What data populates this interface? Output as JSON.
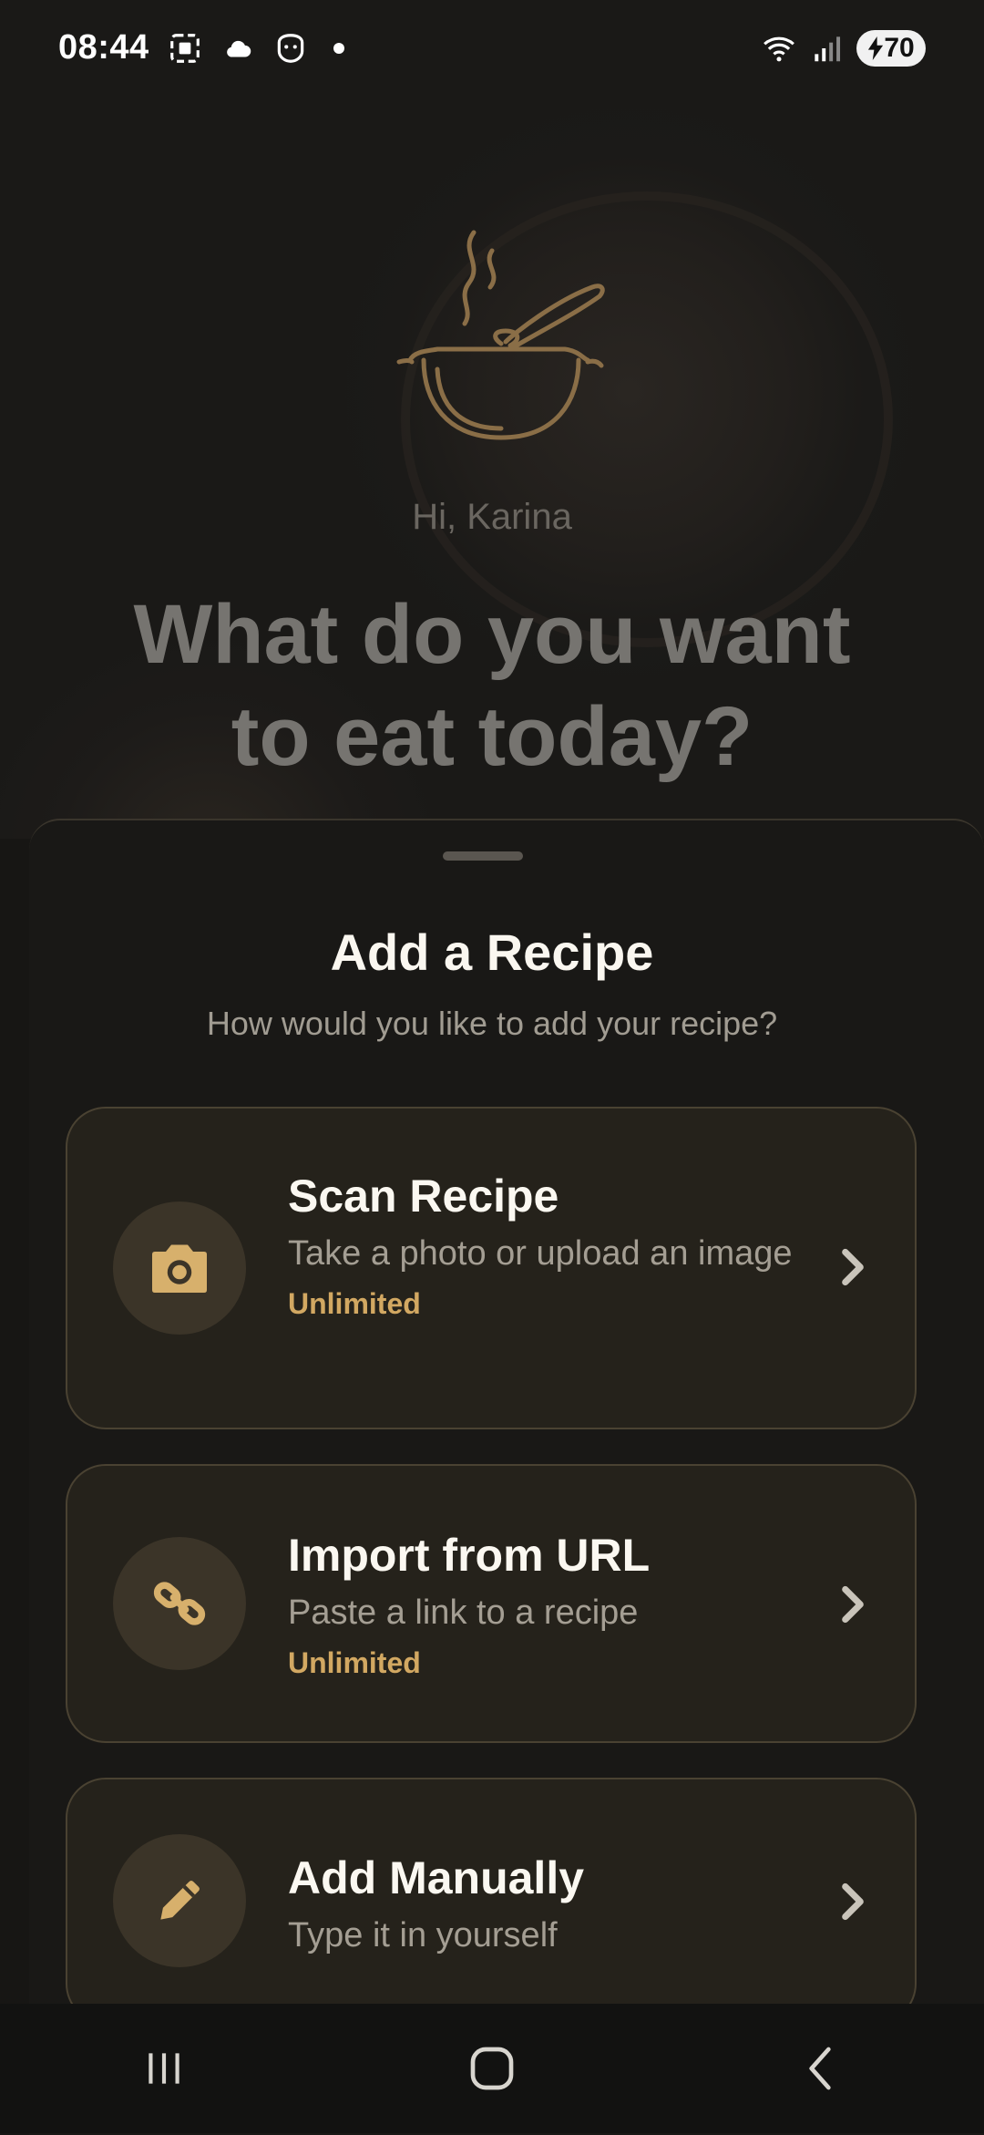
{
  "status_bar": {
    "time": "08:44",
    "battery": "70"
  },
  "hero": {
    "greeting": "Hi, Karina",
    "headline_line1": "What do you want",
    "headline_line2": "to eat today?"
  },
  "sheet": {
    "title": "Add a Recipe",
    "subtitle": "How would you like to add your recipe?"
  },
  "options": [
    {
      "icon": "camera-icon",
      "title": "Scan Recipe",
      "description": "Take a photo or upload an image",
      "badge": "Unlimited"
    },
    {
      "icon": "link-icon",
      "title": "Import from URL",
      "description": "Paste a link to a recipe",
      "badge": "Unlimited"
    },
    {
      "icon": "pencil-icon",
      "title": "Add Manually",
      "description": "Type it in yourself"
    }
  ],
  "colors": {
    "accent": "#d2a862",
    "icon_fill": "#d7b06c",
    "card_bg": "#25221b",
    "card_border": "#4a4232"
  }
}
